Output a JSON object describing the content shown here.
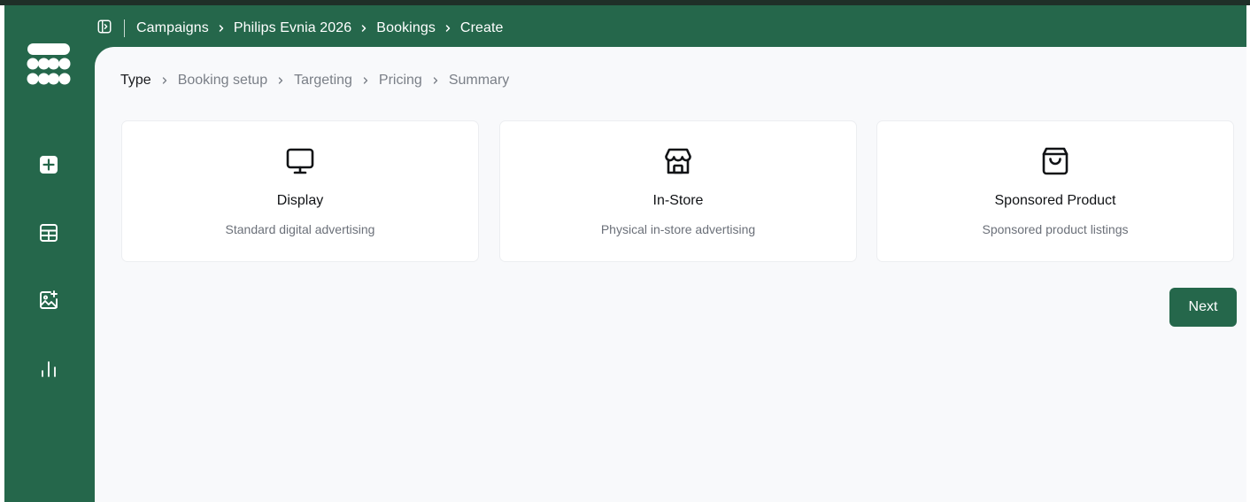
{
  "colors": {
    "brand_green": "#25674b",
    "content_bg": "#f8f9fb",
    "card_bg": "#ffffff",
    "active_step": "#1a1c1f",
    "inactive_step": "#7a7f87"
  },
  "sidebar": {
    "logo_icon": "dotted-grid-logo",
    "items": [
      {
        "icon": "plus-square-icon"
      },
      {
        "icon": "table-grid-icon"
      },
      {
        "icon": "image-add-icon"
      },
      {
        "icon": "bar-chart-icon"
      }
    ]
  },
  "topbar": {
    "toggle_icon": "sidebar-toggle-icon",
    "breadcrumbs": [
      "Campaigns",
      "Philips Evnia 2026",
      "Bookings",
      "Create"
    ]
  },
  "stepper": {
    "steps": [
      "Type",
      "Booking setup",
      "Targeting",
      "Pricing",
      "Summary"
    ],
    "active_index": 0
  },
  "cards": [
    {
      "icon": "monitor-icon",
      "title": "Display",
      "description": "Standard digital advertising"
    },
    {
      "icon": "store-icon",
      "title": "In-Store",
      "description": "Physical in-store advertising"
    },
    {
      "icon": "shopping-bag-icon",
      "title": "Sponsored Product",
      "description": "Sponsored product listings"
    }
  ],
  "actions": {
    "next_label": "Next"
  }
}
